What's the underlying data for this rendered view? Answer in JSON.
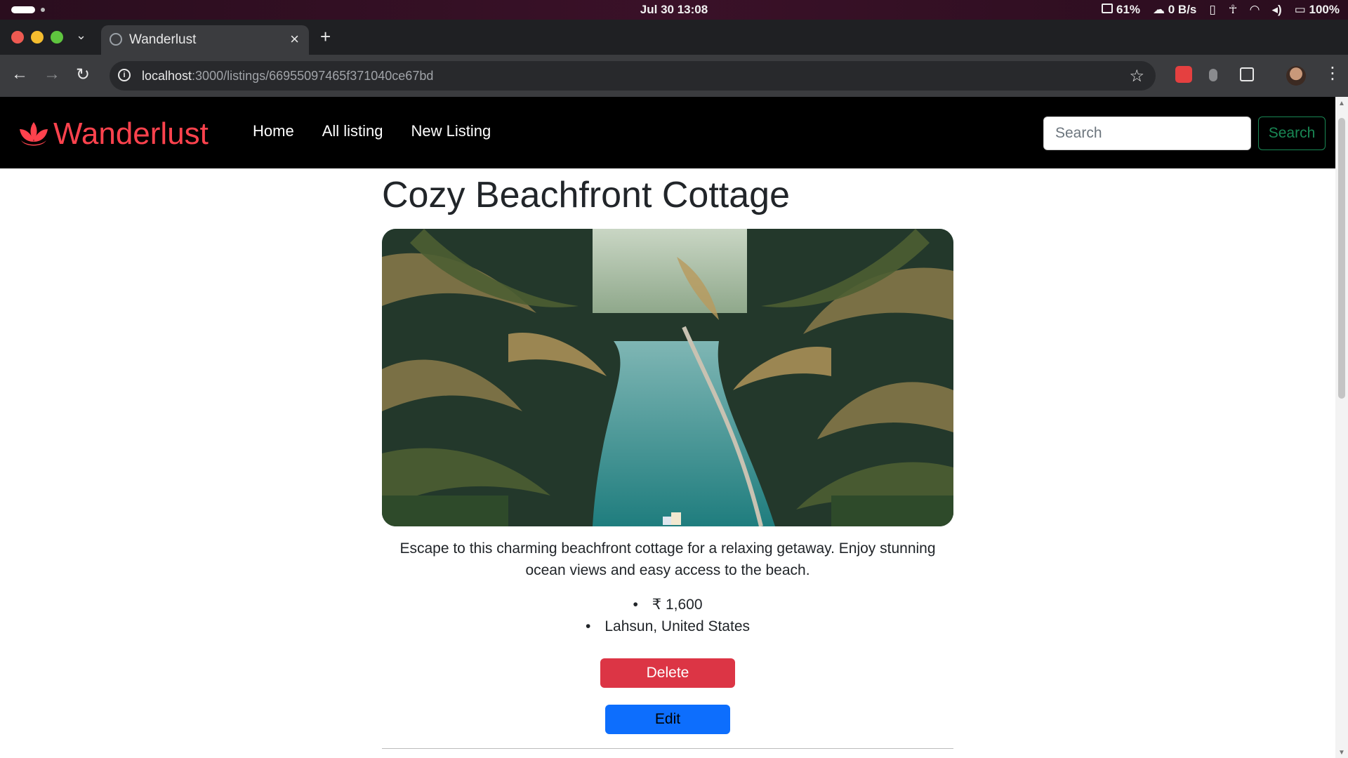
{
  "os": {
    "clock": "Jul 30  13:08",
    "cpu": "61%",
    "network": "0 B/s",
    "battery": "100%"
  },
  "browser": {
    "tab_title": "Wanderlust",
    "url_host": "localhost",
    "url_path": ":3000/listings/66955097465f371040ce67bd"
  },
  "site": {
    "brand": "Wanderlust",
    "brand_color": "#fe424d",
    "nav_links": [
      "Home",
      "All listing",
      "New Listing"
    ],
    "search_placeholder": "Search",
    "search_button": "Search"
  },
  "listing": {
    "title": "Cozy Beachfront Cottage",
    "description": "Escape to this charming beachfront cottage for a relaxing getaway. Enjoy stunning ocean views and easy access to the beach.",
    "price": "₹ 1,600",
    "location": "Lahsun, United States",
    "delete_label": "Delete",
    "edit_label": "Edit",
    "delete_color": "#dc3545",
    "edit_color": "#0d6efd"
  }
}
